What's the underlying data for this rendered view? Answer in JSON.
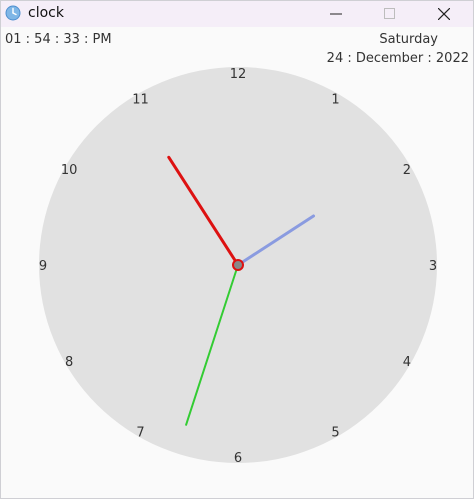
{
  "window": {
    "title": "clock",
    "icon": "clock-icon",
    "controls": [
      "minimize",
      "maximize",
      "close"
    ]
  },
  "time_text": "01 : 54 : 33 : PM",
  "day_text": "Saturday",
  "date_text": "24 : December : 2022",
  "clock": {
    "numerals": [
      "12",
      "1",
      "2",
      "3",
      "4",
      "5",
      "6",
      "7",
      "8",
      "9",
      "10",
      "11"
    ],
    "time": {
      "hour": 1,
      "minute": 54,
      "second": 33
    },
    "colors": {
      "face": "#e1e1e1",
      "hour_hand": "#8a9be0",
      "minute_hand": "#dd1111",
      "second_hand": "#33cc33",
      "center": "#888888"
    }
  }
}
